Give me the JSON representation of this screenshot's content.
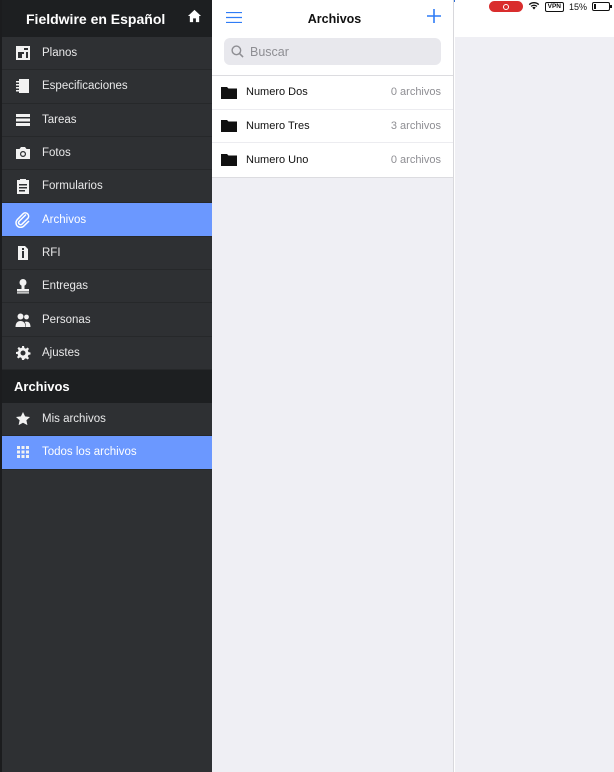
{
  "sidebar": {
    "title": "Fieldwire en Español",
    "items": [
      {
        "label": "Planos",
        "icon": "plans-icon"
      },
      {
        "label": "Especificaciones",
        "icon": "notebook-icon"
      },
      {
        "label": "Tareas",
        "icon": "list-icon"
      },
      {
        "label": "Fotos",
        "icon": "camera-icon"
      },
      {
        "label": "Formularios",
        "icon": "clipboard-icon"
      },
      {
        "label": "Archivos",
        "icon": "paperclip-icon",
        "active": true
      },
      {
        "label": "RFI",
        "icon": "info-document-icon"
      },
      {
        "label": "Entregas",
        "icon": "stamp-icon"
      },
      {
        "label": "Personas",
        "icon": "people-icon"
      },
      {
        "label": "Ajustes",
        "icon": "gear-icon"
      }
    ],
    "section_title": "Archivos",
    "section_items": [
      {
        "label": "Mis archivos",
        "icon": "star-icon"
      },
      {
        "label": "Todos los archivos",
        "icon": "grid-icon",
        "active": true
      }
    ]
  },
  "list": {
    "title": "Archivos",
    "search_placeholder": "Buscar",
    "folders": [
      {
        "name": "Numero Dos",
        "count": "0 archivos"
      },
      {
        "name": "Numero Tres",
        "count": "3 archivos"
      },
      {
        "name": "Numero Uno",
        "count": "0 archivos"
      }
    ]
  },
  "status_bar": {
    "vpn": "VPN",
    "battery": "15%",
    "battery_level": 0.15
  },
  "colors": {
    "accent": "#6b98ff",
    "sidebar_bg": "#2e3033",
    "ios_blue": "#2f7cf6",
    "record": "#d92d2d"
  }
}
